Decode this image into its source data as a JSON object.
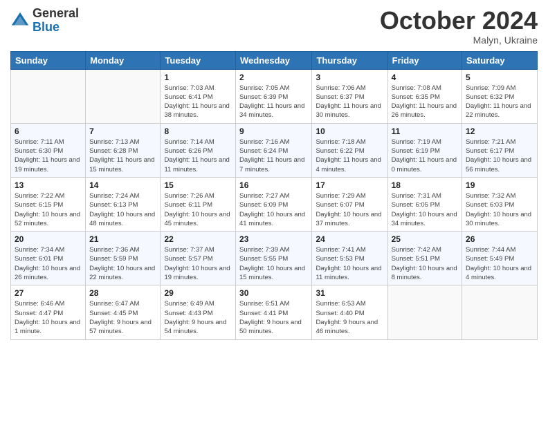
{
  "logo": {
    "general": "General",
    "blue": "Blue"
  },
  "header": {
    "month": "October 2024",
    "location": "Malyn, Ukraine"
  },
  "weekdays": [
    "Sunday",
    "Monday",
    "Tuesday",
    "Wednesday",
    "Thursday",
    "Friday",
    "Saturday"
  ],
  "weeks": [
    [
      {
        "day": "",
        "sunrise": "",
        "sunset": "",
        "daylight": ""
      },
      {
        "day": "",
        "sunrise": "",
        "sunset": "",
        "daylight": ""
      },
      {
        "day": "1",
        "sunrise": "Sunrise: 7:03 AM",
        "sunset": "Sunset: 6:41 PM",
        "daylight": "Daylight: 11 hours and 38 minutes."
      },
      {
        "day": "2",
        "sunrise": "Sunrise: 7:05 AM",
        "sunset": "Sunset: 6:39 PM",
        "daylight": "Daylight: 11 hours and 34 minutes."
      },
      {
        "day": "3",
        "sunrise": "Sunrise: 7:06 AM",
        "sunset": "Sunset: 6:37 PM",
        "daylight": "Daylight: 11 hours and 30 minutes."
      },
      {
        "day": "4",
        "sunrise": "Sunrise: 7:08 AM",
        "sunset": "Sunset: 6:35 PM",
        "daylight": "Daylight: 11 hours and 26 minutes."
      },
      {
        "day": "5",
        "sunrise": "Sunrise: 7:09 AM",
        "sunset": "Sunset: 6:32 PM",
        "daylight": "Daylight: 11 hours and 22 minutes."
      }
    ],
    [
      {
        "day": "6",
        "sunrise": "Sunrise: 7:11 AM",
        "sunset": "Sunset: 6:30 PM",
        "daylight": "Daylight: 11 hours and 19 minutes."
      },
      {
        "day": "7",
        "sunrise": "Sunrise: 7:13 AM",
        "sunset": "Sunset: 6:28 PM",
        "daylight": "Daylight: 11 hours and 15 minutes."
      },
      {
        "day": "8",
        "sunrise": "Sunrise: 7:14 AM",
        "sunset": "Sunset: 6:26 PM",
        "daylight": "Daylight: 11 hours and 11 minutes."
      },
      {
        "day": "9",
        "sunrise": "Sunrise: 7:16 AM",
        "sunset": "Sunset: 6:24 PM",
        "daylight": "Daylight: 11 hours and 7 minutes."
      },
      {
        "day": "10",
        "sunrise": "Sunrise: 7:18 AM",
        "sunset": "Sunset: 6:22 PM",
        "daylight": "Daylight: 11 hours and 4 minutes."
      },
      {
        "day": "11",
        "sunrise": "Sunrise: 7:19 AM",
        "sunset": "Sunset: 6:19 PM",
        "daylight": "Daylight: 11 hours and 0 minutes."
      },
      {
        "day": "12",
        "sunrise": "Sunrise: 7:21 AM",
        "sunset": "Sunset: 6:17 PM",
        "daylight": "Daylight: 10 hours and 56 minutes."
      }
    ],
    [
      {
        "day": "13",
        "sunrise": "Sunrise: 7:22 AM",
        "sunset": "Sunset: 6:15 PM",
        "daylight": "Daylight: 10 hours and 52 minutes."
      },
      {
        "day": "14",
        "sunrise": "Sunrise: 7:24 AM",
        "sunset": "Sunset: 6:13 PM",
        "daylight": "Daylight: 10 hours and 48 minutes."
      },
      {
        "day": "15",
        "sunrise": "Sunrise: 7:26 AM",
        "sunset": "Sunset: 6:11 PM",
        "daylight": "Daylight: 10 hours and 45 minutes."
      },
      {
        "day": "16",
        "sunrise": "Sunrise: 7:27 AM",
        "sunset": "Sunset: 6:09 PM",
        "daylight": "Daylight: 10 hours and 41 minutes."
      },
      {
        "day": "17",
        "sunrise": "Sunrise: 7:29 AM",
        "sunset": "Sunset: 6:07 PM",
        "daylight": "Daylight: 10 hours and 37 minutes."
      },
      {
        "day": "18",
        "sunrise": "Sunrise: 7:31 AM",
        "sunset": "Sunset: 6:05 PM",
        "daylight": "Daylight: 10 hours and 34 minutes."
      },
      {
        "day": "19",
        "sunrise": "Sunrise: 7:32 AM",
        "sunset": "Sunset: 6:03 PM",
        "daylight": "Daylight: 10 hours and 30 minutes."
      }
    ],
    [
      {
        "day": "20",
        "sunrise": "Sunrise: 7:34 AM",
        "sunset": "Sunset: 6:01 PM",
        "daylight": "Daylight: 10 hours and 26 minutes."
      },
      {
        "day": "21",
        "sunrise": "Sunrise: 7:36 AM",
        "sunset": "Sunset: 5:59 PM",
        "daylight": "Daylight: 10 hours and 22 minutes."
      },
      {
        "day": "22",
        "sunrise": "Sunrise: 7:37 AM",
        "sunset": "Sunset: 5:57 PM",
        "daylight": "Daylight: 10 hours and 19 minutes."
      },
      {
        "day": "23",
        "sunrise": "Sunrise: 7:39 AM",
        "sunset": "Sunset: 5:55 PM",
        "daylight": "Daylight: 10 hours and 15 minutes."
      },
      {
        "day": "24",
        "sunrise": "Sunrise: 7:41 AM",
        "sunset": "Sunset: 5:53 PM",
        "daylight": "Daylight: 10 hours and 11 minutes."
      },
      {
        "day": "25",
        "sunrise": "Sunrise: 7:42 AM",
        "sunset": "Sunset: 5:51 PM",
        "daylight": "Daylight: 10 hours and 8 minutes."
      },
      {
        "day": "26",
        "sunrise": "Sunrise: 7:44 AM",
        "sunset": "Sunset: 5:49 PM",
        "daylight": "Daylight: 10 hours and 4 minutes."
      }
    ],
    [
      {
        "day": "27",
        "sunrise": "Sunrise: 6:46 AM",
        "sunset": "Sunset: 4:47 PM",
        "daylight": "Daylight: 10 hours and 1 minute."
      },
      {
        "day": "28",
        "sunrise": "Sunrise: 6:47 AM",
        "sunset": "Sunset: 4:45 PM",
        "daylight": "Daylight: 9 hours and 57 minutes."
      },
      {
        "day": "29",
        "sunrise": "Sunrise: 6:49 AM",
        "sunset": "Sunset: 4:43 PM",
        "daylight": "Daylight: 9 hours and 54 minutes."
      },
      {
        "day": "30",
        "sunrise": "Sunrise: 6:51 AM",
        "sunset": "Sunset: 4:41 PM",
        "daylight": "Daylight: 9 hours and 50 minutes."
      },
      {
        "day": "31",
        "sunrise": "Sunrise: 6:53 AM",
        "sunset": "Sunset: 4:40 PM",
        "daylight": "Daylight: 9 hours and 46 minutes."
      },
      {
        "day": "",
        "sunrise": "",
        "sunset": "",
        "daylight": ""
      },
      {
        "day": "",
        "sunrise": "",
        "sunset": "",
        "daylight": ""
      }
    ]
  ]
}
